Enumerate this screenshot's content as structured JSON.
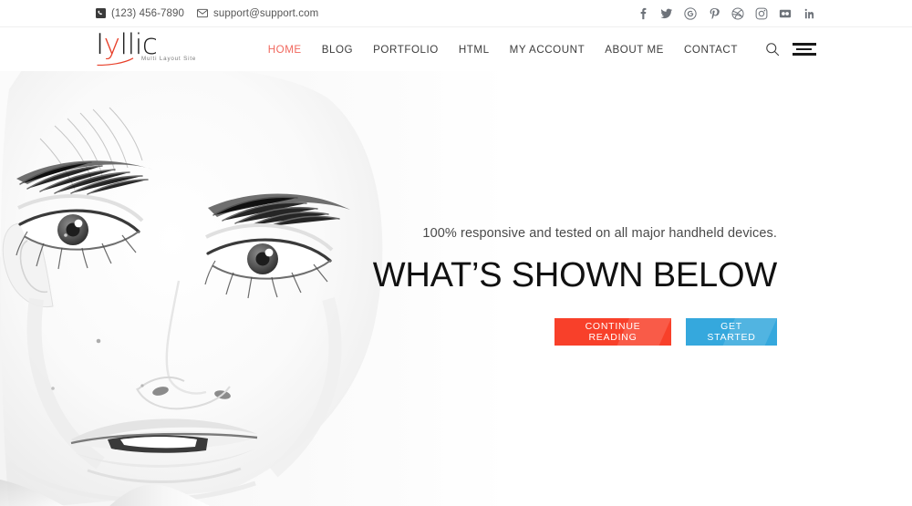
{
  "topbar": {
    "phone": {
      "icon": "phone-icon",
      "text": "(123) 456-7890"
    },
    "email": {
      "icon": "envelope-icon",
      "text": "support@support.com"
    },
    "social": [
      {
        "name": "facebook-icon",
        "label": "f"
      },
      {
        "name": "twitter-icon",
        "label": "t"
      },
      {
        "name": "google-plus-icon",
        "label": "g+"
      },
      {
        "name": "pinterest-icon",
        "label": "p"
      },
      {
        "name": "dribbble-icon",
        "label": "d"
      },
      {
        "name": "instagram-icon",
        "label": "ig"
      },
      {
        "name": "flickr-icon",
        "label": "fl"
      },
      {
        "name": "linkedin-icon",
        "label": "in"
      }
    ]
  },
  "header": {
    "logo": {
      "text": "Idyllic",
      "accent_letter": "y",
      "tagline": "Multi Layout Site"
    },
    "nav": [
      {
        "label": "HOME",
        "active": true
      },
      {
        "label": "BLOG",
        "active": false
      },
      {
        "label": "PORTFOLIO",
        "active": false
      },
      {
        "label": "HTML",
        "active": false
      },
      {
        "label": "MY ACCOUNT",
        "active": false
      },
      {
        "label": "ABOUT ME",
        "active": false
      },
      {
        "label": "CONTACT",
        "active": false
      }
    ],
    "search_icon": "search-icon",
    "menu_icon": "hamburger-menu-icon"
  },
  "hero": {
    "image_alt": "black and white close-up portrait of a woman",
    "subtitle": "100% responsive and tested on all major handheld devices.",
    "title": "WHAT’S SHOWN BELOW",
    "primary_button": "CONTINUE READING",
    "secondary_button": "GET STARTED"
  },
  "colors": {
    "accent_red": "#f8402a",
    "nav_active": "#f1685e",
    "accent_blue": "#35a8dd",
    "logo_accent": "#e8402a",
    "text_dark": "#1b1b1b"
  }
}
